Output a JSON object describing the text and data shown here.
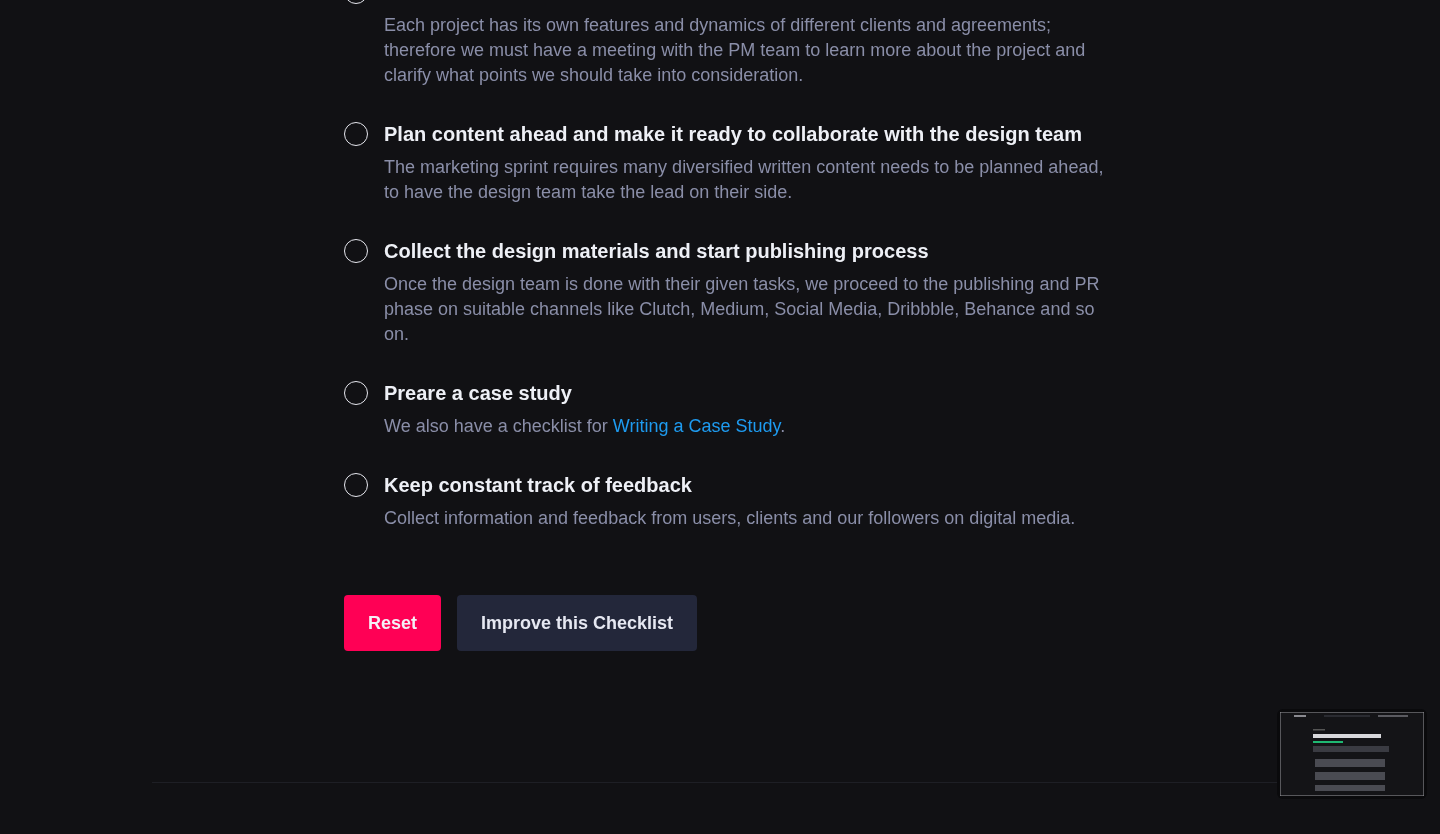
{
  "checklist": [
    {
      "checked": false,
      "description": "Each project has its own features and dynamics of different clients and agreements; therefore we must have a meeting with the PM team to learn more about the project and clarify what points we should take into consideration."
    },
    {
      "checked": false,
      "title": "Plan content ahead and make it ready to collaborate with the design team",
      "description": "The marketing sprint requires many diversified written content needs to be planned ahead, to have the design team take the lead on their side."
    },
    {
      "checked": false,
      "title": "Collect the design materials and start publishing process",
      "description": "Once the design team is done with their given tasks, we proceed to the publishing and PR phase on suitable channels like Clutch, Medium, Social Media, Dribbble, Behance and so on."
    },
    {
      "checked": false,
      "title": "Preare a case study",
      "description": "We also have a checklist for ",
      "link": "Writing a Case Study",
      "after": "."
    },
    {
      "checked": false,
      "title": "Keep constant track of feedback",
      "description": "Collect information and feedback from users, clients and our followers on digital media."
    }
  ],
  "buttons": [
    {
      "label": "Reset",
      "kind": "danger"
    },
    {
      "label": "Improve this Checklist",
      "kind": "secondary"
    }
  ]
}
